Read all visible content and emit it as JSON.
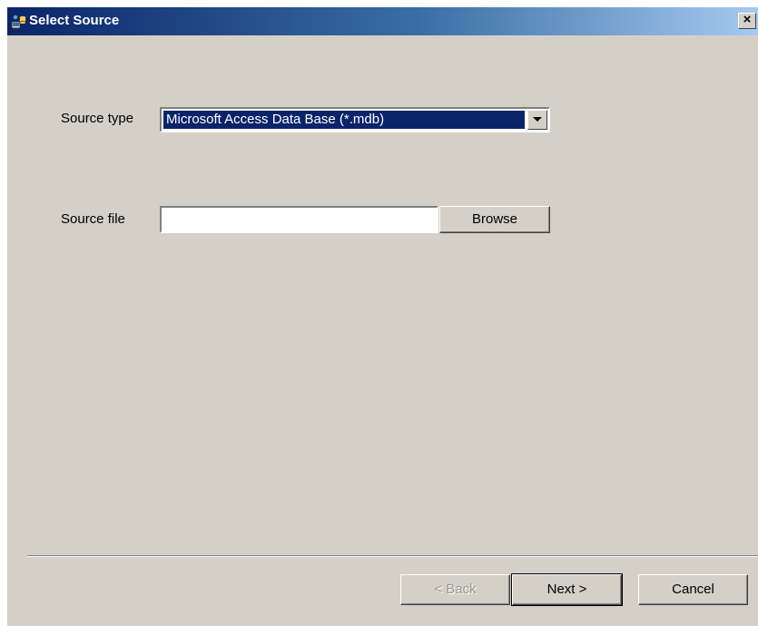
{
  "window": {
    "title": "Select Source",
    "close_glyph": "×",
    "icon": "database-wizard-icon"
  },
  "source_type": {
    "label": "Source type",
    "selected": "Microsoft Access Data Base (*.mdb)"
  },
  "source_file": {
    "label": "Source file",
    "value": "",
    "browse_label": "Browse"
  },
  "footer": {
    "back_label": "< Back",
    "next_label": "Next >",
    "cancel_label": "Cancel"
  },
  "colors": {
    "titlebar_start": "#0a246a",
    "titlebar_end": "#a6caf0",
    "dialog_bg": "#d4d0c8",
    "selection_bg": "#0a246a"
  }
}
